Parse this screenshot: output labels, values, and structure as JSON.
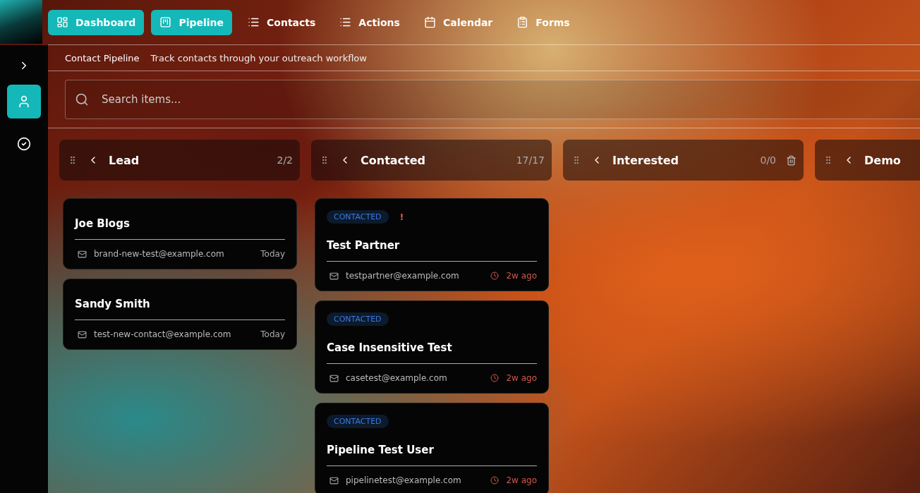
{
  "nav": [
    {
      "label": "Dashboard",
      "selected": true
    },
    {
      "label": "Pipeline",
      "selected": true
    },
    {
      "label": "Contacts",
      "selected": false
    },
    {
      "label": "Actions",
      "selected": false
    },
    {
      "label": "Calendar",
      "selected": false
    },
    {
      "label": "Forms",
      "selected": false
    }
  ],
  "sidebar": {
    "items": [
      {
        "selected": true
      },
      {
        "selected": false
      }
    ]
  },
  "header": {
    "title": "Contact Pipeline",
    "subtitle": "Track contacts through your outreach workflow"
  },
  "search": {
    "placeholder": "Search items..."
  },
  "columns": [
    {
      "title": "Lead",
      "count": "2/2",
      "deletable": false,
      "cards": [
        {
          "name": "Joe Blogs",
          "email": "brand-new-test@example.com",
          "time": "Today",
          "overdue": false
        },
        {
          "name": "Sandy Smith",
          "email": "test-new-contact@example.com",
          "time": "Today",
          "overdue": false
        }
      ]
    },
    {
      "title": "Contacted",
      "count": "17/17",
      "deletable": false,
      "cards": [
        {
          "badge": "CONTACTED",
          "alert": "!",
          "name": "Test Partner",
          "email": "testpartner@example.com",
          "time": "2w ago",
          "overdue": true
        },
        {
          "badge": "CONTACTED",
          "name": "Case Insensitive Test",
          "email": "casetest@example.com",
          "time": "2w ago",
          "overdue": true
        },
        {
          "badge": "CONTACTED",
          "name": "Pipeline Test User",
          "email": "pipelinetest@example.com",
          "time": "2w ago",
          "overdue": true
        }
      ]
    },
    {
      "title": "Interested",
      "count": "0/0",
      "deletable": true
    },
    {
      "title": "Demo"
    }
  ]
}
